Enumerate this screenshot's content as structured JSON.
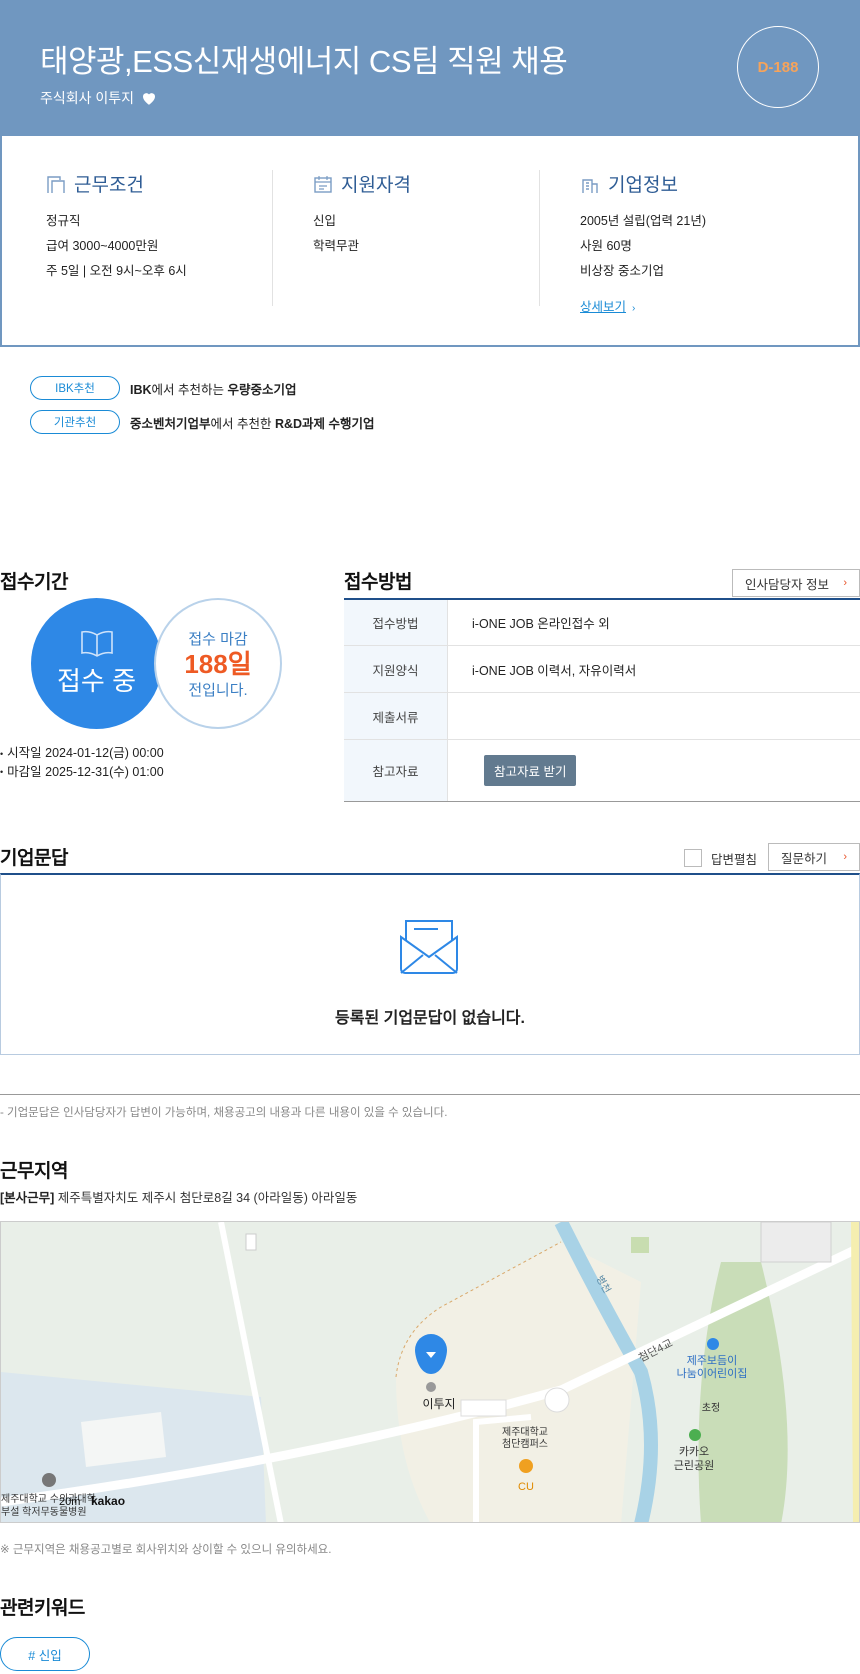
{
  "header": {
    "title": "태양광,ESS신재생에너지 CS팀 직원 채용",
    "company": "주식회사 이투지",
    "dday": "D-188"
  },
  "info": {
    "work": {
      "title": "근무조건",
      "lines": [
        "정규직",
        "급여 3000~4000만원",
        "주 5일 | 오전 9시~오후 6시"
      ]
    },
    "qual": {
      "title": "지원자격",
      "lines": [
        "신입",
        "학력무관"
      ]
    },
    "company": {
      "title": "기업정보",
      "lines": [
        "2005년 설립(업력 21년)",
        "사원 60명",
        "비상장 중소기업"
      ],
      "link": "상세보기"
    }
  },
  "tags": [
    {
      "label": "IBK추천",
      "pre_bold": "IBK",
      "mid": "에서 추천하는 ",
      "post_bold": "우량중소기업",
      "tail": ""
    },
    {
      "label": "기관추천",
      "pre_bold": "중소벤처기업부",
      "mid": "에서 추천한 ",
      "post_bold": "R&D과제 수행기업",
      "tail": ""
    }
  ],
  "period": {
    "title": "접수기간",
    "status": "접수 중",
    "deadline_l1": "접수 마감",
    "deadline_days": "188일",
    "deadline_l3": "전입니다.",
    "start": "시작일 2024-01-12(금) 00:00",
    "end": "마감일 2025-12-31(수) 01:00"
  },
  "method": {
    "title": "접수방법",
    "hr_button": "인사담당자 정보",
    "rows": [
      {
        "k": "접수방법",
        "v": "i-ONE JOB 온라인접수 외"
      },
      {
        "k": "지원양식",
        "v": "i-ONE JOB 이력서, 자유이력서"
      },
      {
        "k": "제출서류",
        "v": ""
      },
      {
        "k": "참고자료",
        "v": "참고자료 받기"
      }
    ]
  },
  "qa": {
    "title": "기업문답",
    "checkbox_label": "답변펼침",
    "ask_button": "질문하기",
    "empty": "등록된 기업문답이 없습니다.",
    "note": "- 기업문답은 인사담당자가 답변이 가능하며, 채용공고의 내용과 다른 내용이 있을 수 있습니다."
  },
  "location": {
    "title": "근무지역",
    "addr_tag": "[본사근무]",
    "address": " 제주특별자치도 제주시 첨단로8길 34 (아라일동) 아라일동",
    "note": "※ 근무지역은 채용공고별로 회사위치와 상이할 수 있으니 유의하세요.",
    "map_labels": {
      "marker": "이투지",
      "campus_1": "제주대학교",
      "campus_2": "첨단캠퍼스",
      "store": "CU",
      "road": "첨단4교",
      "stream": "병천",
      "daycare_1": "제주보듬이",
      "daycare_2": "나눔이어린이집",
      "school": "초정",
      "park_1": "카카오",
      "park_2": "근린공원",
      "uni_1": "제주대학교 수의과대학",
      "uni_2": "부설 학저무동물병원",
      "scale": "20m",
      "brand": "kakao"
    }
  },
  "keywords": {
    "title": "관련키워드",
    "items": [
      "# 신입"
    ]
  },
  "colors": {
    "header_bg": "#7097c0",
    "accent": "#2e88e6",
    "dday": "#f6a35a",
    "deadline": "#ee5a24"
  }
}
